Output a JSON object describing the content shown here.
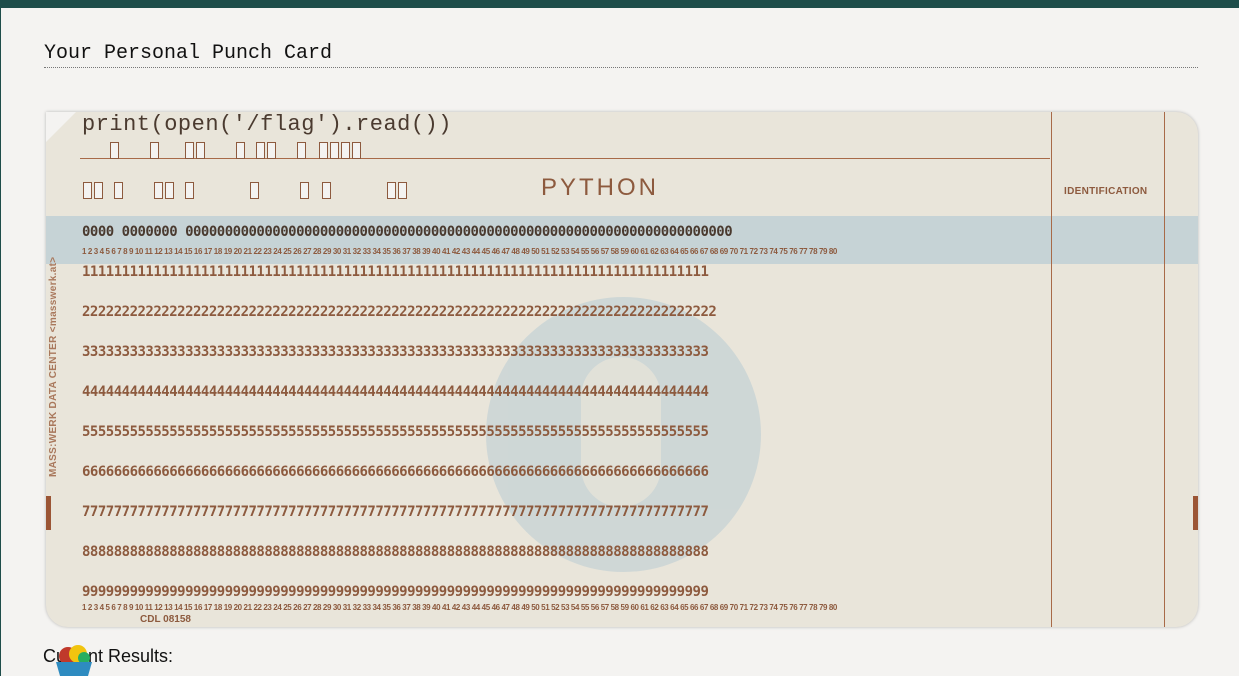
{
  "page": {
    "heading": "Your Personal Punch Card",
    "results_label": "Current Results:"
  },
  "card": {
    "printed_code": "print(open('/flag').read())",
    "language": "PYTHON",
    "identification_label": "IDENTIFICATION",
    "side_label": "MASS:WERK DATA CENTER  <masswerk.at>",
    "cdl": "CDL  08158",
    "rows": {
      "zero": "0000 0000000 000000000000000000000000000000000000000000000000000000000000000000000",
      "one": "1111111111111111111111111111111111111111111111111111111111111111111111111111111",
      "two": "22222222222222222222222222222222222222222222222222222222222222222222222222222222",
      "three": "3333333333333333333333333333333333333333333333333333333333333333333333333333333",
      "four": "4444444444444444444444444444444444444444444444444444444444444444444444444444444",
      "five": "5555555555555555555555555555555555555555555555555555555555555555555555555555555",
      "six": "6666666666666666666666666666666666666666666666666666666666666666666666666666666",
      "seven": "7777777777777777777777777777777777777777777777777777777777777777777777777777777",
      "eight": "8888888888888888888888888888888888888888888888888888888888888888888888888888888",
      "nine": "9999999999999999999999999999999999999999999999999999999999999999999999999999999"
    },
    "column_numbers": "1 2 3 4 5 6 7 8 9 10 11 12 13 14 15 16 17 18 19 20 21 22 23 24 25 26 27 28 29 30 31 32 33 34 35 36 37 38 39 40 41 42 43 44 45 46 47 48 49 50 51 52 53 54 55 56 57 58 59 60 61 62 63 64 65 66 67 68 69 70 71 72 73 74 75 76 77 78 79 80"
  }
}
